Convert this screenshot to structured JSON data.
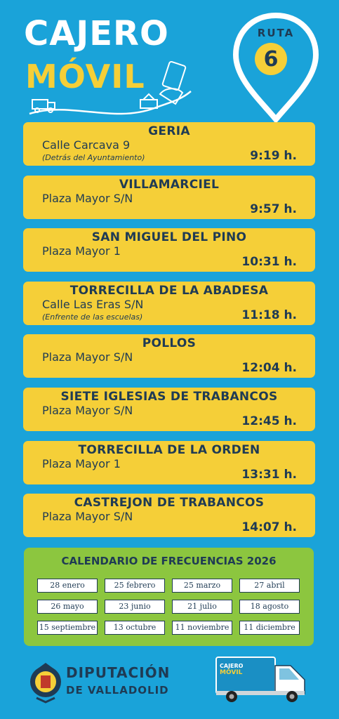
{
  "header": {
    "title_line1": "CAJERO",
    "title_line2": "MÓVIL"
  },
  "route": {
    "label": "RUTA",
    "number": "6"
  },
  "stops": [
    {
      "name": "GERIA",
      "address": "Calle Carcava 9",
      "note": "(Detrás del Ayuntamiento)",
      "time": "9:19 h."
    },
    {
      "name": "VILLAMARCIEL",
      "address": "Plaza Mayor S/N",
      "note": "",
      "time": "9:57 h."
    },
    {
      "name": "SAN MIGUEL DEL PINO",
      "address": "Plaza Mayor 1",
      "note": "",
      "time": "10:31 h."
    },
    {
      "name": "TORRECILLA DE LA ABADESA",
      "address": "Calle Las Eras S/N",
      "note": "(Enfrente de las escuelas)",
      "time": "11:18 h."
    },
    {
      "name": "POLLOS",
      "address": "Plaza Mayor S/N",
      "note": "",
      "time": "12:04 h."
    },
    {
      "name": "SIETE IGLESIAS DE TRABANCOS",
      "address": "Plaza Mayor S/N",
      "note": "",
      "time": "12:45 h."
    },
    {
      "name": "TORRECILLA DE LA ORDEN",
      "address": "Plaza Mayor 1",
      "note": "",
      "time": "13:31 h."
    },
    {
      "name": "CASTREJON DE TRABANCOS",
      "address": "Plaza Mayor S/N",
      "note": "",
      "time": "14:07 h."
    }
  ],
  "calendar": {
    "title": "CALENDARIO DE FRECUENCIAS 2026",
    "dates": [
      "28 enero",
      "25 febrero",
      "25 marzo",
      "27 abril",
      "26 mayo",
      "23 junio",
      "21 julio",
      "18 agosto",
      "15 septiembre",
      "13 octubre",
      "11 noviembre",
      "11 diciembre"
    ]
  },
  "footer": {
    "org_line1": "DIPUTACIÓN",
    "org_line2": "DE VALLADOLID",
    "truck_title1": "CAJERO",
    "truck_title2": "MÓVIL"
  },
  "colors": {
    "background": "#1aa3d9",
    "card": "#f5cf38",
    "calendar": "#8cc63f",
    "text_dark": "#1f3b54"
  },
  "icons": [
    "location-pin-icon",
    "truck-icon",
    "card-hand-icon",
    "coat-of-arms-icon"
  ]
}
